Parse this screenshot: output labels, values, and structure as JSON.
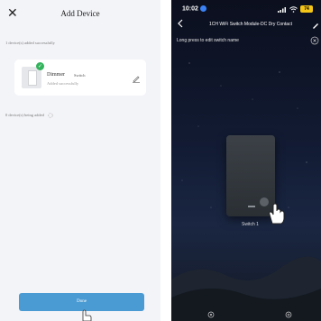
{
  "left": {
    "title": "Add Device",
    "count_added": "1 device(s) added successfully",
    "device": {
      "name": "Dimmer",
      "type": "Switch",
      "status": "Added successfully"
    },
    "count_adding": "0 device(s) being added",
    "done_label": "Done"
  },
  "right": {
    "status": {
      "time": "10:02",
      "battery": "74"
    },
    "nav_title": "1CH WiFi Switch Module-DC Dry Contact",
    "hint": "Long press to edit switch name",
    "switch_label": "Switch 1"
  },
  "colors": {
    "accent": "#4a9bd3",
    "success": "#33b35c",
    "battery": "#f5c518"
  }
}
